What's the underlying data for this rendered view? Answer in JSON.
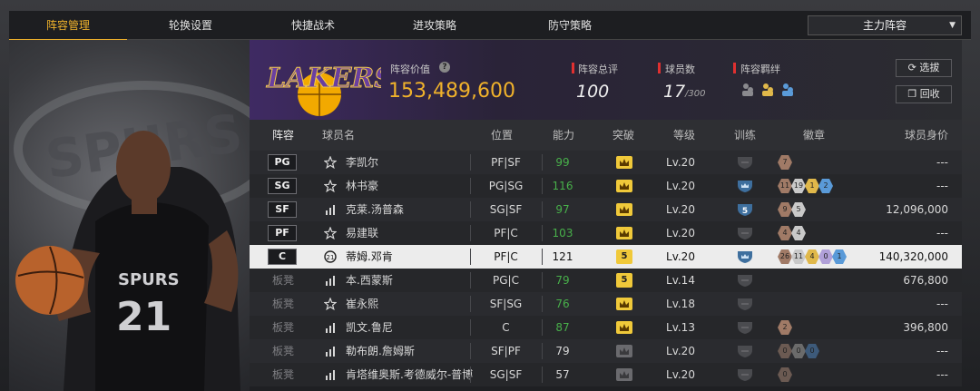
{
  "tabs": [
    {
      "label": "阵容管理",
      "active": true
    },
    {
      "label": "轮换设置",
      "active": false
    },
    {
      "label": "快捷战术",
      "active": false
    },
    {
      "label": "进攻策略",
      "active": false
    },
    {
      "label": "防守策略",
      "active": false
    }
  ],
  "lineup_select": {
    "value": "主力阵容"
  },
  "hero": {
    "team_logo_text": "SPURS",
    "jersey_number": "21"
  },
  "header": {
    "logo_text": "LAKERS",
    "value_label": "阵容价值",
    "value": "153,489,600",
    "rating_label": "阵容总评",
    "rating": "100",
    "count_label": "球员数",
    "count": "17",
    "count_max": "/300",
    "bond_label": "阵容羁绊",
    "btn_select": "选拔",
    "btn_recycle": "回收"
  },
  "columns": {
    "lineup": "阵容",
    "name": "球员名",
    "position": "位置",
    "ability": "能力",
    "breakthrough": "突破",
    "level": "等级",
    "training": "训练",
    "badges": "徽章",
    "value": "球员身价"
  },
  "rows": [
    {
      "slot": "PG",
      "icon": "star-icon",
      "name": "李凯尔",
      "pos": "PF|SF",
      "ability": "99",
      "green": true,
      "brk": "crown",
      "level": "Lv.20",
      "train": "gray",
      "badges": [
        [
          "7",
          "#a07a66"
        ]
      ],
      "value": "---"
    },
    {
      "slot": "SG",
      "icon": "star-icon",
      "name": "林书豪",
      "pos": "PG|SG",
      "ability": "116",
      "green": true,
      "brk": "crown",
      "level": "Lv.20",
      "train": "blue",
      "badges": [
        [
          "11",
          "#a07a66"
        ],
        [
          "19",
          "#c9c9c9"
        ],
        [
          "1",
          "#e0b84a"
        ],
        [
          "2",
          "#5a9ad8"
        ]
      ],
      "value": "---"
    },
    {
      "slot": "SF",
      "icon": "bars-icon",
      "name": "克莱.汤普森",
      "pos": "SG|SF",
      "ability": "97",
      "green": true,
      "brk": "crown",
      "level": "Lv.20",
      "train": "blue5",
      "badges": [
        [
          "9",
          "#a07a66"
        ],
        [
          "5",
          "#c9c9c9"
        ]
      ],
      "value": "12,096,000"
    },
    {
      "slot": "PF",
      "icon": "star-icon",
      "name": "易建联",
      "pos": "PF|C",
      "ability": "103",
      "green": true,
      "brk": "crown",
      "level": "Lv.20",
      "train": "gray",
      "badges": [
        [
          "4",
          "#a07a66"
        ],
        [
          "4",
          "#c9c9c9"
        ]
      ],
      "value": "---"
    },
    {
      "slot": "C",
      "icon": "tag-icon",
      "name": "蒂姆.邓肯",
      "pos": "PF|C",
      "ability": "121",
      "green": false,
      "brk": "5",
      "level": "Lv.20",
      "train": "blue",
      "badges": [
        [
          "26",
          "#a07a66"
        ],
        [
          "11",
          "#c9c9c9"
        ],
        [
          "4",
          "#e0b84a"
        ],
        [
          "0",
          "#b0a0d8"
        ],
        [
          "1",
          "#5a9ad8"
        ]
      ],
      "value": "140,320,000"
    },
    {
      "slot": "板凳",
      "icon": "bars-icon",
      "name": "本.西蒙斯",
      "pos": "PG|C",
      "ability": "79",
      "green": true,
      "brk": "5",
      "level": "Lv.14",
      "train": "gray",
      "badges": [],
      "value": "676,800"
    },
    {
      "slot": "板凳",
      "icon": "star-icon",
      "name": "崔永熙",
      "pos": "SF|SG",
      "ability": "76",
      "green": true,
      "brk": "crown",
      "level": "Lv.18",
      "train": "gray",
      "badges": [],
      "value": "---"
    },
    {
      "slot": "板凳",
      "icon": "bars-icon",
      "name": "凯文.鲁尼",
      "pos": "C",
      "ability": "87",
      "green": true,
      "brk": "crown",
      "level": "Lv.13",
      "train": "gray",
      "badges": [
        [
          "2",
          "#a07a66"
        ]
      ],
      "value": "396,800"
    },
    {
      "slot": "板凳",
      "icon": "bars-icon",
      "name": "勒布朗.詹姆斯",
      "pos": "SF|PF",
      "ability": "79",
      "green": false,
      "brk": "gray",
      "level": "Lv.20",
      "train": "gray",
      "badges": [
        [
          "0",
          "#6b5a52"
        ],
        [
          "0",
          "#6b6b6b"
        ],
        [
          "0",
          "#3d5a7a"
        ]
      ],
      "value": "---"
    },
    {
      "slot": "板凳",
      "icon": "bars-icon",
      "name": "肯塔维奥斯.考德威尔-普博",
      "pos": "SG|SF",
      "ability": "57",
      "green": false,
      "brk": "gray",
      "level": "Lv.20",
      "train": "gray",
      "badges": [
        [
          "0",
          "#6b5a52"
        ]
      ],
      "value": "---"
    }
  ]
}
